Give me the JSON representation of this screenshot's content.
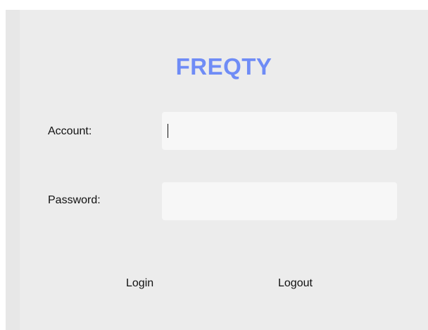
{
  "app": {
    "title": "FREQTY"
  },
  "form": {
    "account_label": "Account:",
    "account_value": "",
    "password_label": "Password:",
    "password_value": ""
  },
  "actions": {
    "login_label": "Login",
    "logout_label": "Logout"
  },
  "colors": {
    "title": "#6f8cf6",
    "panel_background": "#ececec",
    "field_background": "#f7f7f7"
  }
}
